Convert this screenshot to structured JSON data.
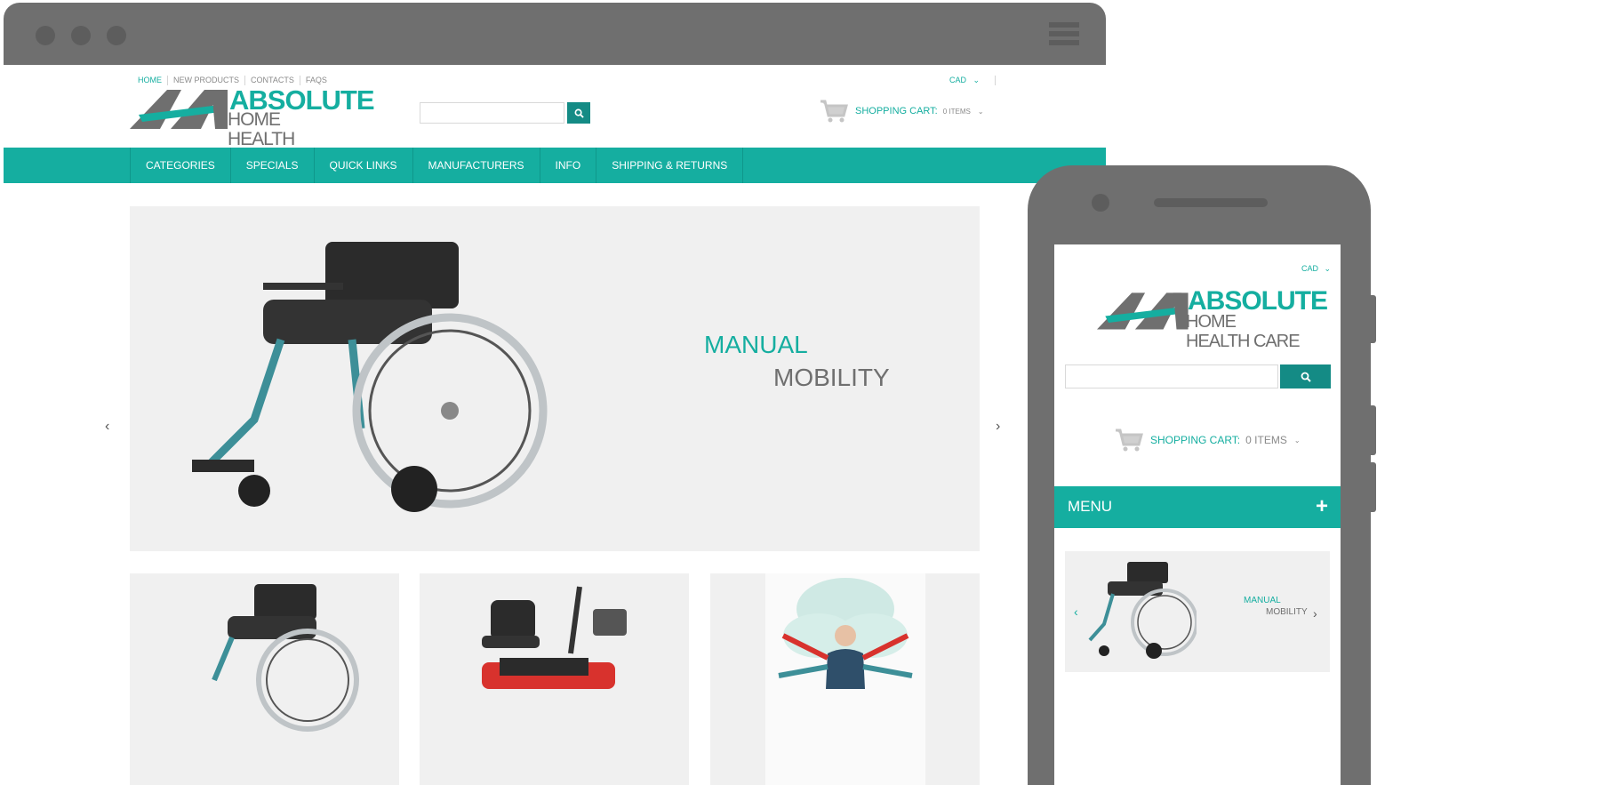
{
  "top_nav": [
    "HOME",
    "NEW PRODUCTS",
    "CONTACTS",
    "FAQS"
  ],
  "currency": "CAD",
  "logo": {
    "line1": "ABSOLUTE",
    "line2": "HOME HEALTH CARE"
  },
  "search": {
    "placeholder": ""
  },
  "cart": {
    "label": "SHOPPING CART:",
    "items": "0 ITEMS"
  },
  "main_nav": [
    "CATEGORIES",
    "SPECIALS",
    "QUICK LINKS",
    "MANUFACTURERS",
    "INFO",
    "SHIPPING & RETURNS"
  ],
  "hero": {
    "title1": "MANUAL",
    "title2": "MOBILITY"
  },
  "mobile": {
    "currency": "CAD",
    "cart_label": "SHOPPING CART:",
    "cart_items": "0 ITEMS",
    "menu_label": "MENU",
    "hero_title1": "MANUAL",
    "hero_title2": "MOBILITY"
  },
  "colors": {
    "accent": "#15aea0",
    "dark_accent": "#148b85",
    "frame": "#6f6f6f",
    "hero_bg": "#f0f0f0"
  }
}
